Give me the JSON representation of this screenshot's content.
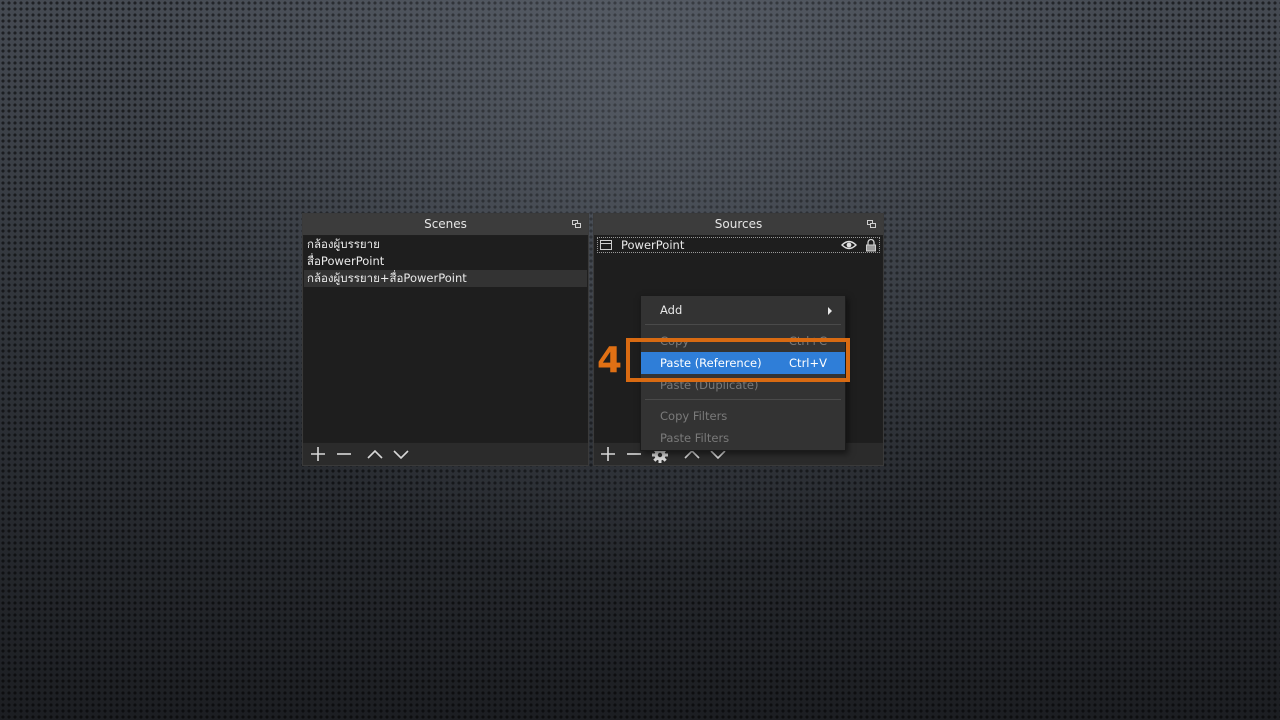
{
  "scenes": {
    "title": "Scenes",
    "items": [
      {
        "label": "กล้องผู้บรรยาย"
      },
      {
        "label": "สื่อPowerPoint"
      },
      {
        "label": "กล้องผู้บรรยาย+สื่อPowerPoint",
        "selected": true
      }
    ]
  },
  "sources": {
    "title": "Sources",
    "items": [
      {
        "label": "PowerPoint",
        "visible": true,
        "locked": true
      }
    ]
  },
  "context_menu": {
    "add": "Add",
    "copy": "Copy",
    "copy_shortcut": "Ctrl+C",
    "paste_reference": "Paste (Reference)",
    "paste_reference_shortcut": "Ctrl+V",
    "paste_duplicate": "Paste (Duplicate)",
    "copy_filters": "Copy Filters",
    "paste_filters": "Paste Filters"
  },
  "annotation": {
    "step": "4",
    "color": "#d86a12"
  },
  "colors": {
    "highlight": "#2f7ed8",
    "panel": "#1f1f1f",
    "title_bar": "#3c3c3c"
  },
  "icons": {
    "add": "plus-icon",
    "remove": "minus-icon",
    "up": "chevron-up-icon",
    "down": "chevron-down-icon",
    "properties": "gear-icon",
    "visibility": "eye-icon",
    "lock": "lock-icon",
    "source_type": "window-icon"
  }
}
